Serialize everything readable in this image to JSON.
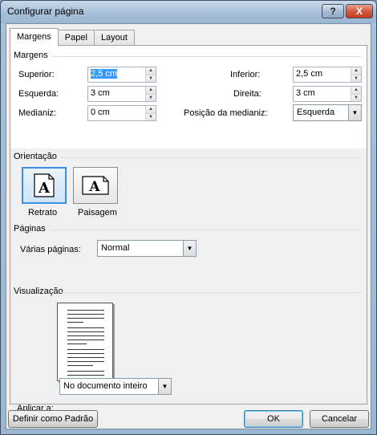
{
  "window": {
    "title": "Configurar página",
    "help_glyph": "?",
    "close_glyph": "X"
  },
  "tabs": [
    {
      "label": "Margens",
      "active": true
    },
    {
      "label": "Papel",
      "active": false
    },
    {
      "label": "Layout",
      "active": false
    }
  ],
  "margins": {
    "group_label": "Margens",
    "superior": {
      "label": "Superior:",
      "value": "2,5 cm"
    },
    "inferior": {
      "label": "Inferior:",
      "value": "2,5 cm"
    },
    "esquerda": {
      "label": "Esquerda:",
      "value": "3 cm"
    },
    "direita": {
      "label": "Direita:",
      "value": "3 cm"
    },
    "medianiz": {
      "label": "Medianiz:",
      "value": "0 cm"
    },
    "posicao_medianiz": {
      "label": "Posição da medianiz:",
      "value": "Esquerda"
    }
  },
  "orientation": {
    "group_label": "Orientação",
    "retrato": {
      "label": "Retrato",
      "glyph": "A",
      "selected": true
    },
    "paisagem": {
      "label": "Paisagem",
      "glyph": "A",
      "selected": false
    }
  },
  "pages": {
    "group_label": "Páginas",
    "varias_label": "Várias páginas:",
    "varias_value": "Normal"
  },
  "preview": {
    "group_label": "Visualização"
  },
  "apply": {
    "label": "Aplicar a:",
    "value": "No documento inteiro"
  },
  "buttons": {
    "default": "Definir como Padrão",
    "ok": "OK",
    "cancel": "Cancelar"
  },
  "icons": {
    "spin_up": "▲",
    "spin_down": "▼",
    "dropdown": "▼"
  }
}
